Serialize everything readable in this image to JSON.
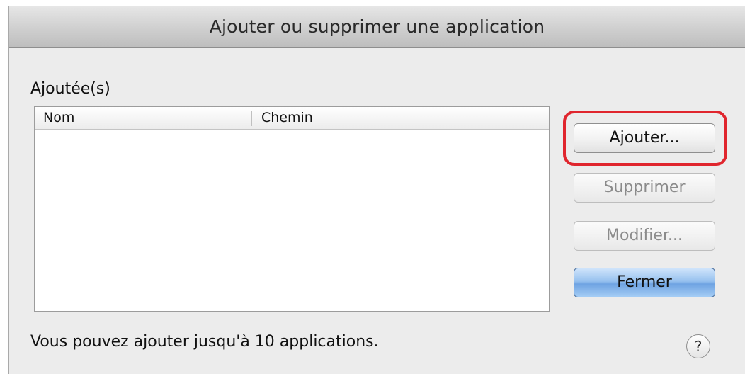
{
  "window": {
    "title": "Ajouter ou supprimer une application"
  },
  "list": {
    "label": "Ajoutée(s)",
    "columns": [
      "Nom",
      "Chemin"
    ],
    "rows": []
  },
  "buttons": {
    "add": "Ajouter...",
    "remove": "Supprimer",
    "edit": "Modifier...",
    "close": "Fermer"
  },
  "footer": {
    "hint": "Vous pouvez ajouter jusqu'à 10 applications.",
    "help": "?"
  },
  "colors": {
    "highlight": "#e0262e",
    "default_button": "#7fb0e8"
  },
  "icons": {
    "help": "help-icon"
  }
}
